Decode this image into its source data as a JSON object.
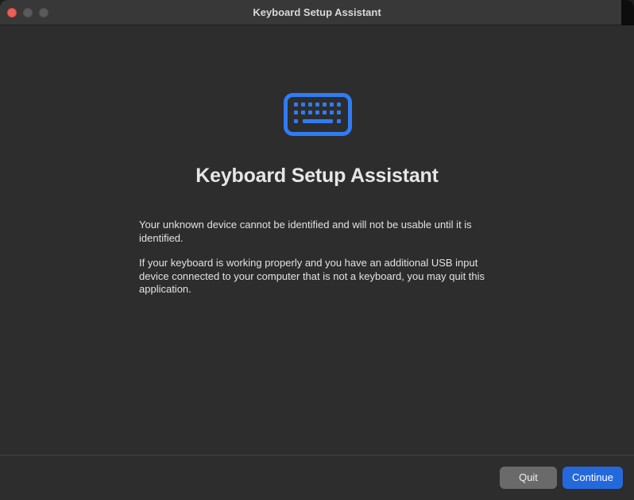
{
  "window": {
    "title": "Keyboard Setup Assistant"
  },
  "main": {
    "icon": "keyboard-icon",
    "heading": "Keyboard Setup Assistant",
    "paragraph1": "Your unknown device cannot be identified and will not be usable until it is identified.",
    "paragraph2": "If your keyboard is working properly and you have an additional USB input device connected to your computer that is not a keyboard, you may quit this application."
  },
  "footer": {
    "quit_label": "Quit",
    "continue_label": "Continue"
  },
  "colors": {
    "accent": "#2469dc",
    "icon": "#2f7cf6",
    "close": "#ec5f57"
  }
}
